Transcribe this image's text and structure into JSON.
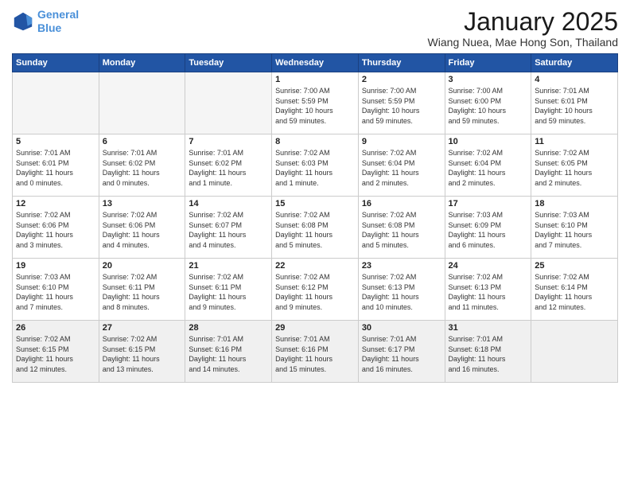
{
  "logo": {
    "line1": "General",
    "line2": "Blue"
  },
  "title": "January 2025",
  "subtitle": "Wiang Nuea, Mae Hong Son, Thailand",
  "weekdays": [
    "Sunday",
    "Monday",
    "Tuesday",
    "Wednesday",
    "Thursday",
    "Friday",
    "Saturday"
  ],
  "weeks": [
    [
      {
        "day": "",
        "info": ""
      },
      {
        "day": "",
        "info": ""
      },
      {
        "day": "",
        "info": ""
      },
      {
        "day": "1",
        "info": "Sunrise: 7:00 AM\nSunset: 5:59 PM\nDaylight: 10 hours\nand 59 minutes."
      },
      {
        "day": "2",
        "info": "Sunrise: 7:00 AM\nSunset: 5:59 PM\nDaylight: 10 hours\nand 59 minutes."
      },
      {
        "day": "3",
        "info": "Sunrise: 7:00 AM\nSunset: 6:00 PM\nDaylight: 10 hours\nand 59 minutes."
      },
      {
        "day": "4",
        "info": "Sunrise: 7:01 AM\nSunset: 6:01 PM\nDaylight: 10 hours\nand 59 minutes."
      }
    ],
    [
      {
        "day": "5",
        "info": "Sunrise: 7:01 AM\nSunset: 6:01 PM\nDaylight: 11 hours\nand 0 minutes."
      },
      {
        "day": "6",
        "info": "Sunrise: 7:01 AM\nSunset: 6:02 PM\nDaylight: 11 hours\nand 0 minutes."
      },
      {
        "day": "7",
        "info": "Sunrise: 7:01 AM\nSunset: 6:02 PM\nDaylight: 11 hours\nand 1 minute."
      },
      {
        "day": "8",
        "info": "Sunrise: 7:02 AM\nSunset: 6:03 PM\nDaylight: 11 hours\nand 1 minute."
      },
      {
        "day": "9",
        "info": "Sunrise: 7:02 AM\nSunset: 6:04 PM\nDaylight: 11 hours\nand 2 minutes."
      },
      {
        "day": "10",
        "info": "Sunrise: 7:02 AM\nSunset: 6:04 PM\nDaylight: 11 hours\nand 2 minutes."
      },
      {
        "day": "11",
        "info": "Sunrise: 7:02 AM\nSunset: 6:05 PM\nDaylight: 11 hours\nand 2 minutes."
      }
    ],
    [
      {
        "day": "12",
        "info": "Sunrise: 7:02 AM\nSunset: 6:06 PM\nDaylight: 11 hours\nand 3 minutes."
      },
      {
        "day": "13",
        "info": "Sunrise: 7:02 AM\nSunset: 6:06 PM\nDaylight: 11 hours\nand 4 minutes."
      },
      {
        "day": "14",
        "info": "Sunrise: 7:02 AM\nSunset: 6:07 PM\nDaylight: 11 hours\nand 4 minutes."
      },
      {
        "day": "15",
        "info": "Sunrise: 7:02 AM\nSunset: 6:08 PM\nDaylight: 11 hours\nand 5 minutes."
      },
      {
        "day": "16",
        "info": "Sunrise: 7:02 AM\nSunset: 6:08 PM\nDaylight: 11 hours\nand 5 minutes."
      },
      {
        "day": "17",
        "info": "Sunrise: 7:03 AM\nSunset: 6:09 PM\nDaylight: 11 hours\nand 6 minutes."
      },
      {
        "day": "18",
        "info": "Sunrise: 7:03 AM\nSunset: 6:10 PM\nDaylight: 11 hours\nand 7 minutes."
      }
    ],
    [
      {
        "day": "19",
        "info": "Sunrise: 7:03 AM\nSunset: 6:10 PM\nDaylight: 11 hours\nand 7 minutes."
      },
      {
        "day": "20",
        "info": "Sunrise: 7:02 AM\nSunset: 6:11 PM\nDaylight: 11 hours\nand 8 minutes."
      },
      {
        "day": "21",
        "info": "Sunrise: 7:02 AM\nSunset: 6:11 PM\nDaylight: 11 hours\nand 9 minutes."
      },
      {
        "day": "22",
        "info": "Sunrise: 7:02 AM\nSunset: 6:12 PM\nDaylight: 11 hours\nand 9 minutes."
      },
      {
        "day": "23",
        "info": "Sunrise: 7:02 AM\nSunset: 6:13 PM\nDaylight: 11 hours\nand 10 minutes."
      },
      {
        "day": "24",
        "info": "Sunrise: 7:02 AM\nSunset: 6:13 PM\nDaylight: 11 hours\nand 11 minutes."
      },
      {
        "day": "25",
        "info": "Sunrise: 7:02 AM\nSunset: 6:14 PM\nDaylight: 11 hours\nand 12 minutes."
      }
    ],
    [
      {
        "day": "26",
        "info": "Sunrise: 7:02 AM\nSunset: 6:15 PM\nDaylight: 11 hours\nand 12 minutes."
      },
      {
        "day": "27",
        "info": "Sunrise: 7:02 AM\nSunset: 6:15 PM\nDaylight: 11 hours\nand 13 minutes."
      },
      {
        "day": "28",
        "info": "Sunrise: 7:01 AM\nSunset: 6:16 PM\nDaylight: 11 hours\nand 14 minutes."
      },
      {
        "day": "29",
        "info": "Sunrise: 7:01 AM\nSunset: 6:16 PM\nDaylight: 11 hours\nand 15 minutes."
      },
      {
        "day": "30",
        "info": "Sunrise: 7:01 AM\nSunset: 6:17 PM\nDaylight: 11 hours\nand 16 minutes."
      },
      {
        "day": "31",
        "info": "Sunrise: 7:01 AM\nSunset: 6:18 PM\nDaylight: 11 hours\nand 16 minutes."
      },
      {
        "day": "",
        "info": ""
      }
    ]
  ]
}
